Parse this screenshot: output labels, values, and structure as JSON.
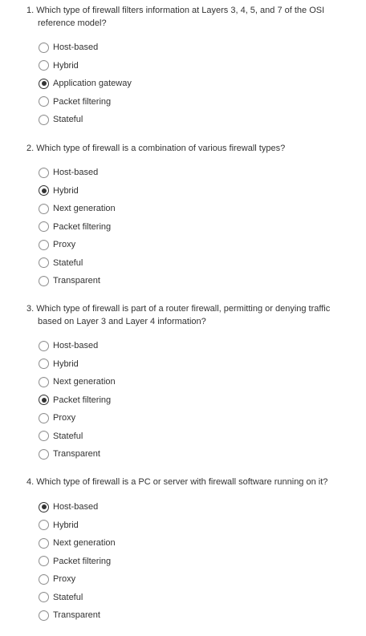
{
  "questions": [
    {
      "number": "1.",
      "text": "Which type of firewall filters information at Layers 3, 4, 5, and 7 of the OSI reference model?",
      "options": [
        {
          "label": "Host-based",
          "selected": false
        },
        {
          "label": "Hybrid",
          "selected": false
        },
        {
          "label": "Application gateway",
          "selected": true
        },
        {
          "label": "Packet filtering",
          "selected": false
        },
        {
          "label": "Stateful",
          "selected": false
        }
      ]
    },
    {
      "number": "2.",
      "text": "Which type of firewall is a combination of various firewall types?",
      "options": [
        {
          "label": "Host-based",
          "selected": false
        },
        {
          "label": "Hybrid",
          "selected": true
        },
        {
          "label": "Next generation",
          "selected": false
        },
        {
          "label": "Packet filtering",
          "selected": false
        },
        {
          "label": "Proxy",
          "selected": false
        },
        {
          "label": "Stateful",
          "selected": false
        },
        {
          "label": "Transparent",
          "selected": false
        }
      ]
    },
    {
      "number": "3.",
      "text": "Which type of firewall is part of a router firewall, permitting or denying traffic based on Layer 3 and Layer 4 information?",
      "options": [
        {
          "label": "Host-based",
          "selected": false
        },
        {
          "label": "Hybrid",
          "selected": false
        },
        {
          "label": "Next generation",
          "selected": false
        },
        {
          "label": "Packet filtering",
          "selected": true
        },
        {
          "label": "Proxy",
          "selected": false
        },
        {
          "label": "Stateful",
          "selected": false
        },
        {
          "label": "Transparent",
          "selected": false
        }
      ]
    },
    {
      "number": "4.",
      "text": "Which type of firewall is a PC or server with firewall software running on it?",
      "options": [
        {
          "label": "Host-based",
          "selected": true
        },
        {
          "label": "Hybrid",
          "selected": false
        },
        {
          "label": "Next generation",
          "selected": false
        },
        {
          "label": "Packet filtering",
          "selected": false
        },
        {
          "label": "Proxy",
          "selected": false
        },
        {
          "label": "Stateful",
          "selected": false
        },
        {
          "label": "Transparent",
          "selected": false
        }
      ]
    }
  ]
}
